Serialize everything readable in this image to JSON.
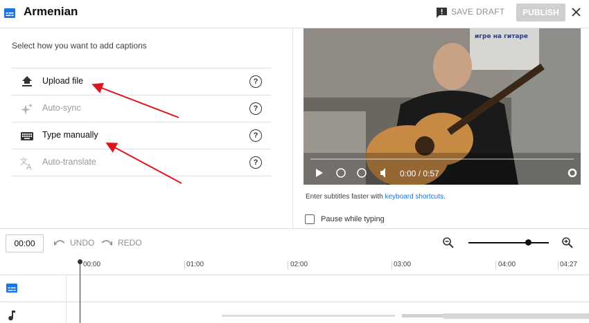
{
  "header": {
    "title": "Armenian",
    "save_draft": "SAVE DRAFT",
    "publish": "PUBLISH",
    "icons": [
      "subtitles-icon",
      "feedback-icon",
      "close-icon"
    ]
  },
  "left_panel": {
    "prompt": "Select how you want to add captions",
    "options": [
      {
        "label": "Upload file",
        "icon": "upload-icon",
        "enabled": true
      },
      {
        "label": "Auto-sync",
        "icon": "sparkle-icon",
        "enabled": false
      },
      {
        "label": "Type manually",
        "icon": "keyboard-icon",
        "enabled": true
      },
      {
        "label": "Auto-translate",
        "icon": "translate-icon",
        "enabled": false
      }
    ],
    "help_glyph": "?"
  },
  "video": {
    "time": "0:00 / 0:57",
    "sign_text": "игре на гитаре"
  },
  "editor": {
    "hint_prefix": "Enter subtitles faster with ",
    "hint_link": "keyboard shortcuts",
    "hint_suffix": ".",
    "pause_label": "Pause while typing",
    "pause_checked": false
  },
  "toolbar": {
    "time": "00:00",
    "undo": "UNDO",
    "redo": "REDO"
  },
  "timeline": {
    "ticks": [
      "00:00",
      "01:00",
      "02:00",
      "03:00",
      "04:00",
      "04:27"
    ]
  },
  "colors": {
    "accent": "#1a73e8",
    "arrow": "#e0141e"
  }
}
